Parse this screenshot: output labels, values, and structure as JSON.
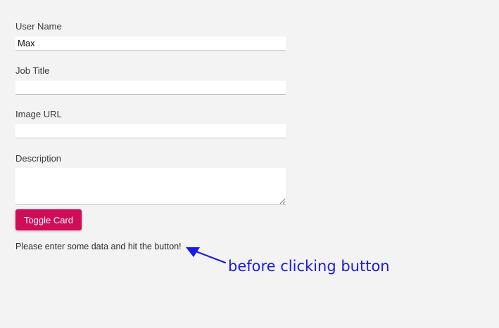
{
  "form": {
    "user_name": {
      "label": "User Name",
      "value": "Max"
    },
    "job_title": {
      "label": "Job Title",
      "value": ""
    },
    "image_url": {
      "label": "Image URL",
      "value": ""
    },
    "description": {
      "label": "Description",
      "value": ""
    }
  },
  "toggle_button": {
    "label": "Toggle Card"
  },
  "message": "Please enter some data and hit the button!",
  "annotation": {
    "text": "before clicking button",
    "color": "#1a1ae6",
    "icon": "arrow-left-icon"
  },
  "colors": {
    "background": "#f3f3f3",
    "accent": "#d10d5a"
  }
}
